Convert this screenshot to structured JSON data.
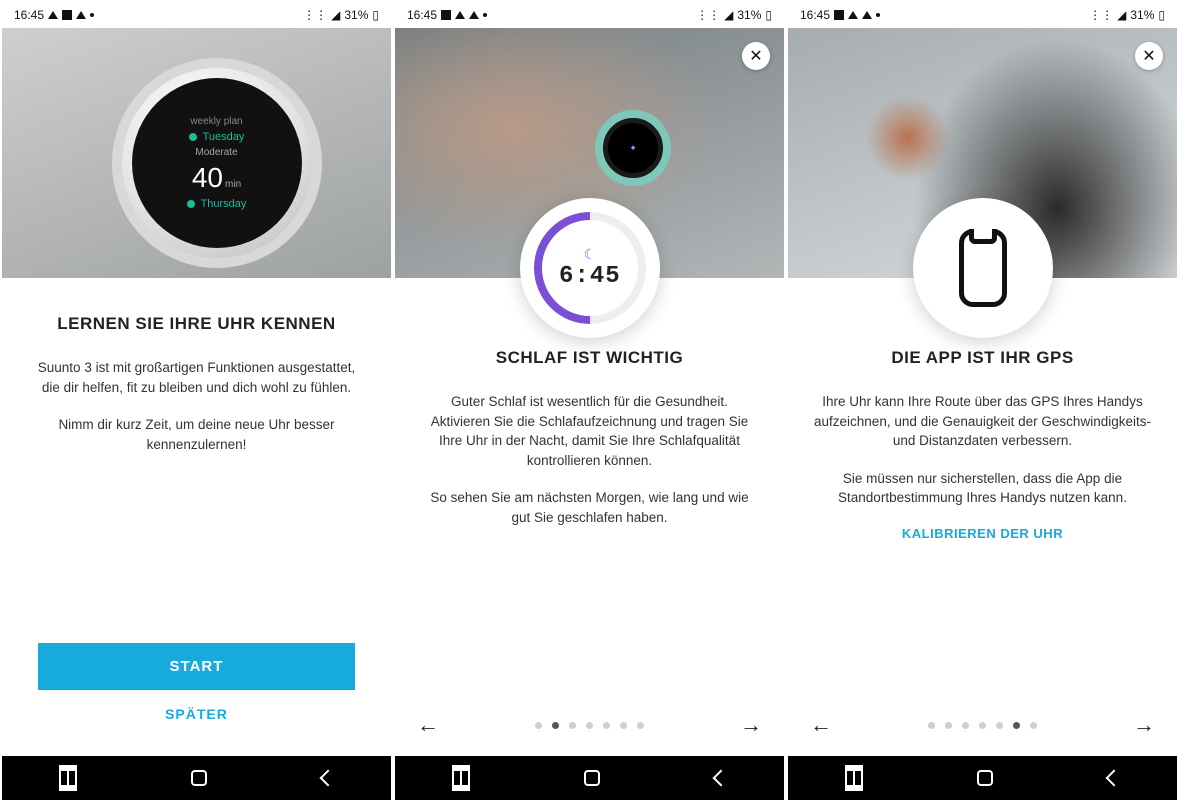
{
  "status": {
    "time": "16:45",
    "battery": "31%"
  },
  "screen1": {
    "title": "LERNEN SIE IHRE UHR KENNEN",
    "p1": "Suunto 3 ist mit großartigen Funktionen ausgestattet, die dir helfen, fit zu bleiben und dich wohl zu fühlen.",
    "p2": "Nimm dir kurz Zeit, um deine neue Uhr besser kennenzulernen!",
    "primary": "START",
    "secondary": "SPÄTER",
    "watch": {
      "header": "weekly plan",
      "day1": "Tuesday",
      "mode": "Moderate",
      "value": "40",
      "unit": "min",
      "day2": "Thursday"
    }
  },
  "screen2": {
    "title": "SCHLAF IST WICHTIG",
    "p1": "Guter Schlaf ist wesentlich für die Gesundheit. Aktivieren Sie die Schlafaufzeichnung und tragen Sie Ihre Uhr in der Nacht, damit Sie Ihre Schlafqualität kontrollieren können.",
    "p2": "So sehen Sie am nächsten Morgen, wie lang und wie gut Sie geschlafen haben.",
    "sleep_time": "6:45",
    "dots_total": 7,
    "dot_active": 1
  },
  "screen3": {
    "title": "DIE APP IST IHR GPS",
    "p1": "Ihre Uhr kann Ihre Route über das GPS Ihres Handys aufzeichnen, und die Genauigkeit der Geschwindigkeits- und Distanzdaten verbessern.",
    "p2": "Sie müssen nur sicherstellen, dass die App die Standortbestimmung Ihres Handys nutzen kann.",
    "cta": "KALIBRIEREN DER UHR",
    "dots_total": 7,
    "dot_active": 5
  }
}
